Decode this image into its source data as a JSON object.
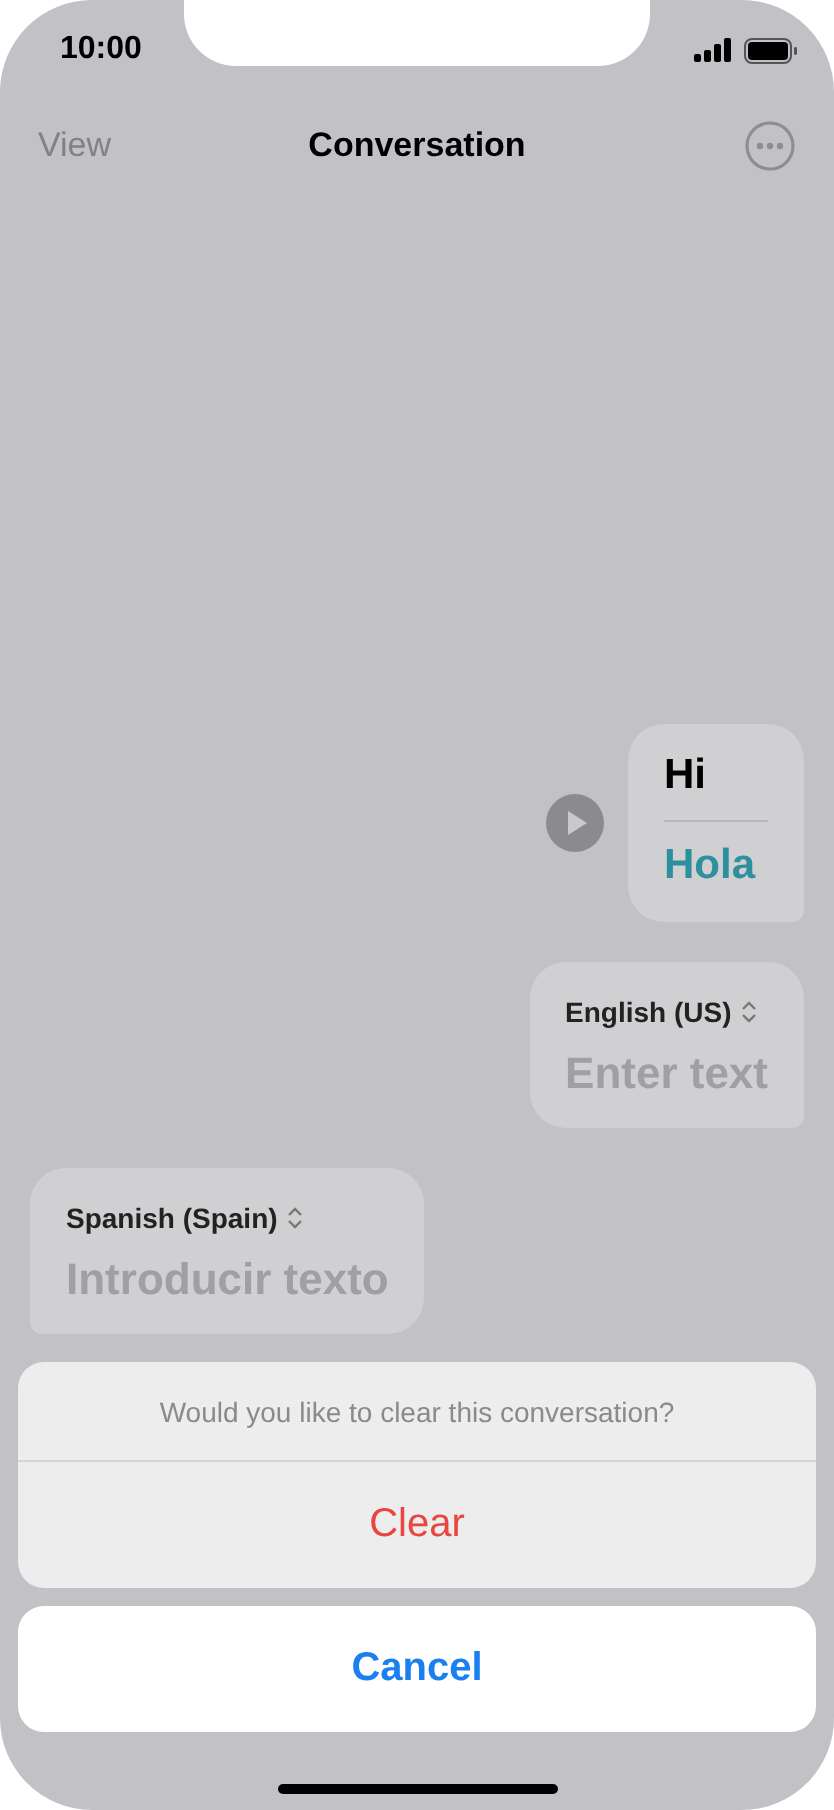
{
  "status_bar": {
    "time": "10:00"
  },
  "nav": {
    "left": "View",
    "title": "Conversation"
  },
  "messages": [
    {
      "kind": "translation",
      "incoming": false,
      "source": "Hi",
      "translation": "Hola"
    },
    {
      "kind": "input",
      "incoming": false,
      "language": "English (US)",
      "placeholder": "Enter text"
    },
    {
      "kind": "input",
      "incoming": true,
      "language": "Spanish (Spain)",
      "placeholder": "Introducir texto"
    }
  ],
  "action_sheet": {
    "message": "Would you like to clear this conversation?",
    "actions": [
      {
        "label": "Clear",
        "kind": "destructive"
      }
    ],
    "cancel": "Cancel"
  }
}
